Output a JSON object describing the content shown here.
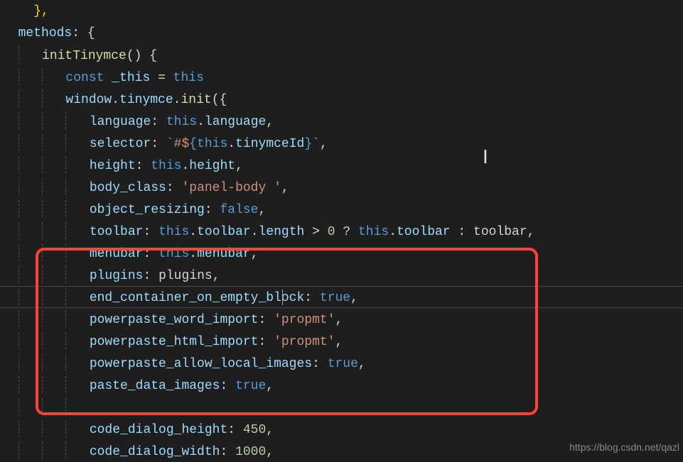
{
  "code": {
    "line0_braceclose": "  },",
    "line1": {
      "k": "methods",
      "rest": ": {"
    },
    "line2": {
      "name": "initTinymce",
      "rest": "() {"
    },
    "line3": {
      "const": "const",
      "var": "_this",
      "eq": " = ",
      "this": "this"
    },
    "line4": {
      "obj": "window",
      "dot1": ".",
      "mod": "tinymce",
      "dot2": ".",
      "fn": "init",
      "open": "({"
    },
    "line5": {
      "key": "language",
      "colon": ": ",
      "this": "this",
      "dot": ".",
      "prop": "language",
      "comma": ","
    },
    "line6": {
      "key": "selector",
      "colon": ": ",
      "tpl_open": "`#$",
      "brace_open": "{",
      "this": "this",
      "dot": ".",
      "prop": "tinymceId",
      "brace_close": "}",
      "tpl_close": "`",
      "comma": ","
    },
    "line7": {
      "key": "height",
      "colon": ": ",
      "this": "this",
      "dot": ".",
      "prop": "height",
      "comma": ","
    },
    "line8": {
      "key": "body_class",
      "colon": ": ",
      "str": "'panel-body '",
      "comma": ","
    },
    "line9": {
      "key": "object_resizing",
      "colon": ": ",
      "bool": "false",
      "comma": ","
    },
    "line10": {
      "key": "toolbar",
      "colon": ": ",
      "this": "this",
      "dot": ".",
      "prop": "toolbar",
      "dot2": ".",
      "len": "length",
      "op": " > ",
      "num": "0",
      "q": " ? ",
      "this2": "this",
      "dot3": ".",
      "prop2": "toolbar",
      "c": " : ",
      "id": "toolbar",
      "comma": ","
    },
    "line11": {
      "key": "menubar",
      "colon": ": ",
      "this": "this",
      "dot": ".",
      "prop": "menubar",
      "comma": ","
    },
    "line12": {
      "key": "plugins",
      "colon": ": ",
      "id": "plugins",
      "comma": ","
    },
    "line13": {
      "key": "end_container_on_empty_block",
      "colon": ": ",
      "bool": "true",
      "comma": ","
    },
    "line14": {
      "key": "powerpaste_word_import",
      "colon": ": ",
      "str": "'propmt'",
      "comma": ","
    },
    "line15": {
      "key": "powerpaste_html_import",
      "colon": ": ",
      "str": "'propmt'",
      "comma": ","
    },
    "line16": {
      "key": "powerpaste_allow_local_images",
      "colon": ": ",
      "bool": "true",
      "comma": ","
    },
    "line17": {
      "key": "paste_data_images",
      "colon": ": ",
      "bool": "true",
      "comma": ","
    },
    "line18": {
      "blank": " "
    },
    "line19": {
      "key": "code_dialog_height",
      "colon": ": ",
      "num": "450",
      "comma": ","
    },
    "line20": {
      "key": "code_dialog_width",
      "colon": ": ",
      "num": "1000",
      "comma": ","
    }
  },
  "watermark": "https://blog.csdn.net/qazl",
  "ibeam": "I"
}
